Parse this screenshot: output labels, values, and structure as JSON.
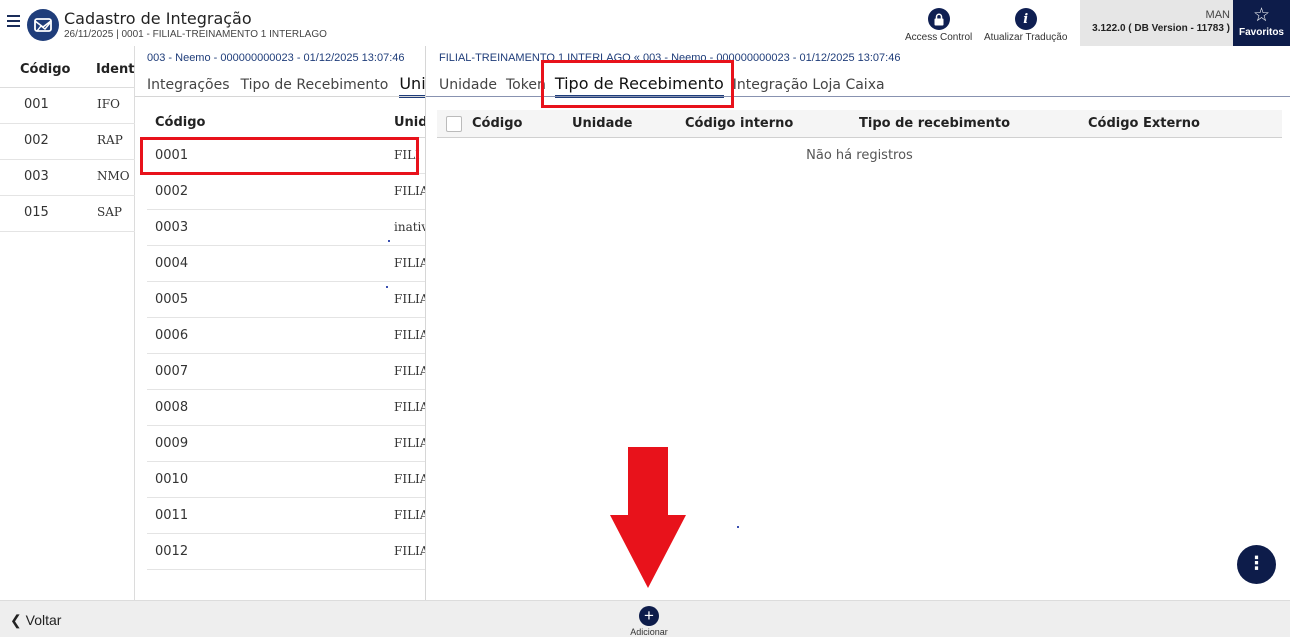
{
  "header": {
    "title": "Cadastro de Integração",
    "subtitle": "26/11/2025 | 0001 - FILIAL-TREINAMENTO 1 INTERLAGO",
    "access_control_label": "Access Control",
    "translate_label": "Atualizar Tradução",
    "user": "MAN",
    "version": "3.122.0 ( DB Version - 11783 )",
    "favorites_label": "Favoritos"
  },
  "left_panel": {
    "columns": [
      "Código",
      "Identi"
    ],
    "rows": [
      {
        "code": "001",
        "ident": "IFO"
      },
      {
        "code": "002",
        "ident": "RAP"
      },
      {
        "code": "003",
        "ident": "NMO"
      },
      {
        "code": "015",
        "ident": "SAP"
      }
    ]
  },
  "middle_panel": {
    "breadcrumb": "003 - Neemo - 000000000023 - 01/12/2025 13:07:46",
    "tabs": [
      "Integrações",
      "Tipo de Recebimento"
    ],
    "active_tab": "Unida",
    "columns": [
      "Código",
      "Unid"
    ],
    "rows": [
      {
        "code": "0001",
        "unit": "FILI"
      },
      {
        "code": "0002",
        "unit": "FILIA"
      },
      {
        "code": "0003",
        "unit": "inativ"
      },
      {
        "code": "0004",
        "unit": "FILIA"
      },
      {
        "code": "0005",
        "unit": "FILIA"
      },
      {
        "code": "0006",
        "unit": "FILIA"
      },
      {
        "code": "0007",
        "unit": "FILIA"
      },
      {
        "code": "0008",
        "unit": "FILIA"
      },
      {
        "code": "0009",
        "unit": "FILIA"
      },
      {
        "code": "0010",
        "unit": "FILIA"
      },
      {
        "code": "0011",
        "unit": "FILIA"
      },
      {
        "code": "0012",
        "unit": "FILIA"
      }
    ]
  },
  "right_panel": {
    "breadcrumb": "FILIAL-TREINAMENTO 1 INTERLAGO « 003 - Neemo - 000000000023 - 01/12/2025 13:07:46",
    "tabs_before": [
      "Unidade",
      "Token"
    ],
    "active_tab": "Tipo de Recebimento",
    "tabs_after": [
      "Integração Loja Caixa"
    ],
    "columns": [
      "Código",
      "Unidade",
      "Código interno",
      "Tipo de recebimento",
      "Código Externo"
    ],
    "empty_message": "Não há registros"
  },
  "bottom_bar": {
    "back_label": "Voltar",
    "add_label": "Adicionar"
  },
  "colors": {
    "primary": "#0d1c4a",
    "highlight": "#e8121b"
  }
}
